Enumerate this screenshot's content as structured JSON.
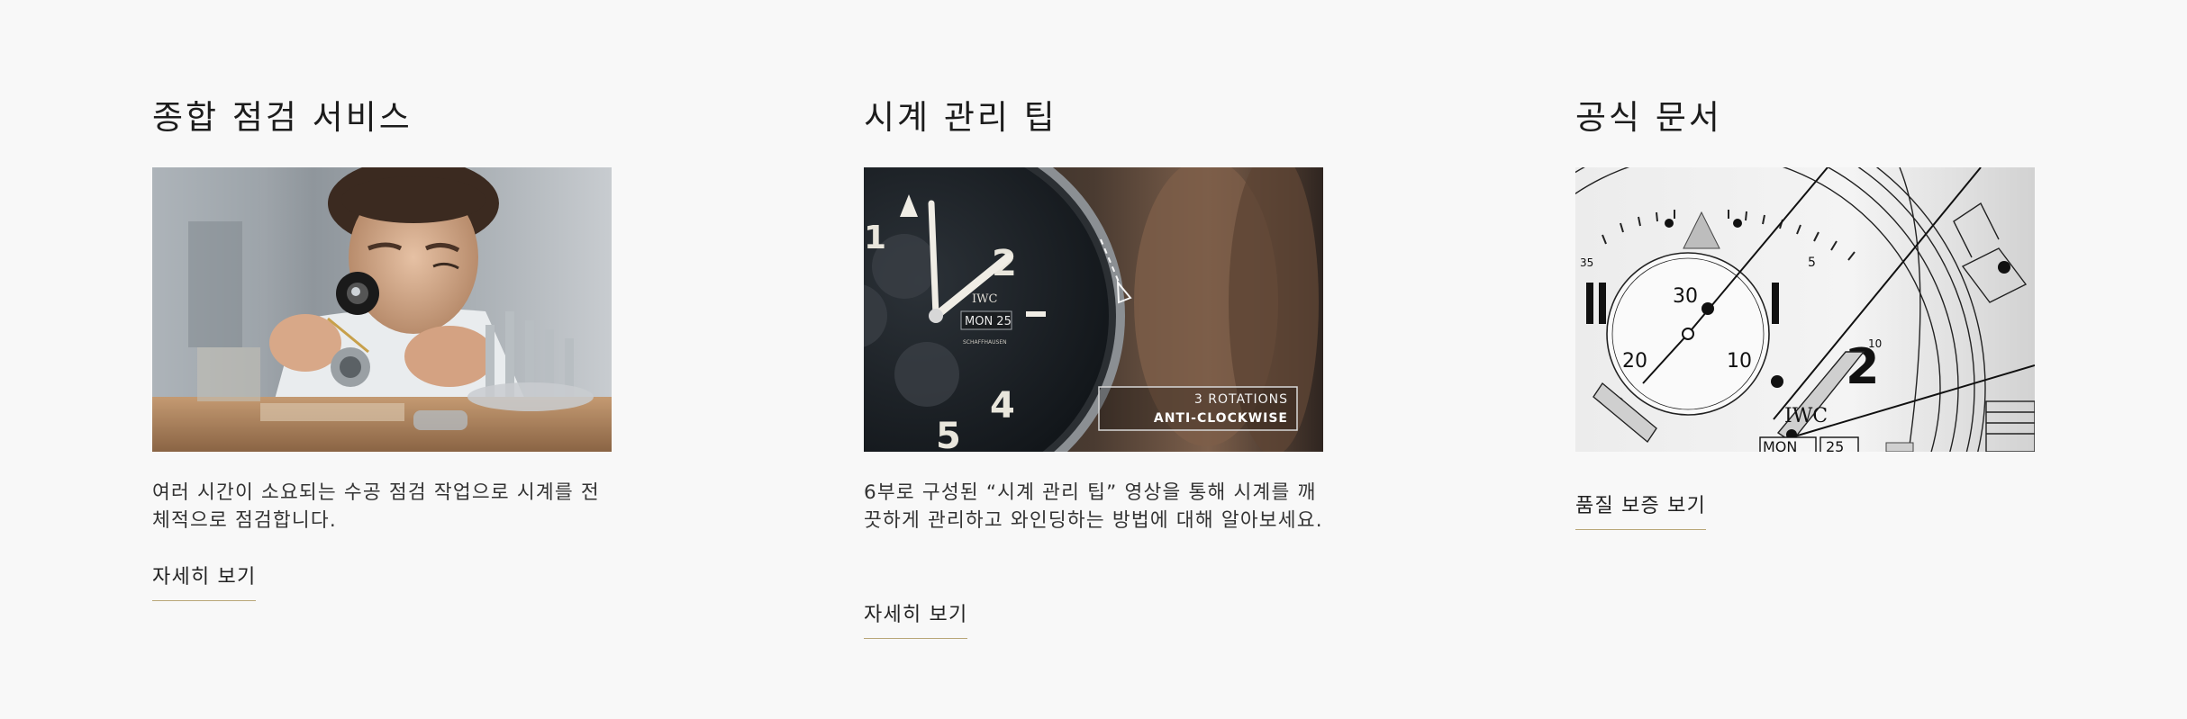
{
  "cards": [
    {
      "title": "종합 점검 서비스",
      "description": "여러 시간이 소요되는 수공 점검 작업으로 시계를 전체적으로 점검합니다.",
      "link_label": "자세히 보기",
      "image_alt": "watchmaker-inspecting-movement"
    },
    {
      "title": "시계 관리 팁",
      "description": "6부로 구성된 “시계 관리 팁” 영상을 통해 시계를 깨끗하게 관리하고 와인딩하는 방법에 대해 알아보세요.",
      "link_label": "자세히 보기",
      "image_alt": "chronograph-crown-winding",
      "overlay": {
        "line1": "3 ROTATIONS",
        "line2": "ANTI-CLOCKWISE"
      },
      "dial": {
        "brand": "IWC",
        "date_label": "MON 25",
        "maker": "SCHAFFHAUSEN"
      }
    },
    {
      "title": "공식 문서",
      "link_label": "품질 보증 보기",
      "image_alt": "chronograph-technical-drawing",
      "drawing": {
        "brand": "IWC",
        "date_label": "MON",
        "date_num": "25",
        "subdial_numbers": [
          "30",
          "20",
          "10"
        ],
        "dial_numbers": [
          "2",
          "5",
          "10",
          "35"
        ]
      }
    }
  ],
  "colors": {
    "background": "#f8f8f8",
    "link_underline": "#b9a778",
    "title": "#1c1c1c"
  }
}
